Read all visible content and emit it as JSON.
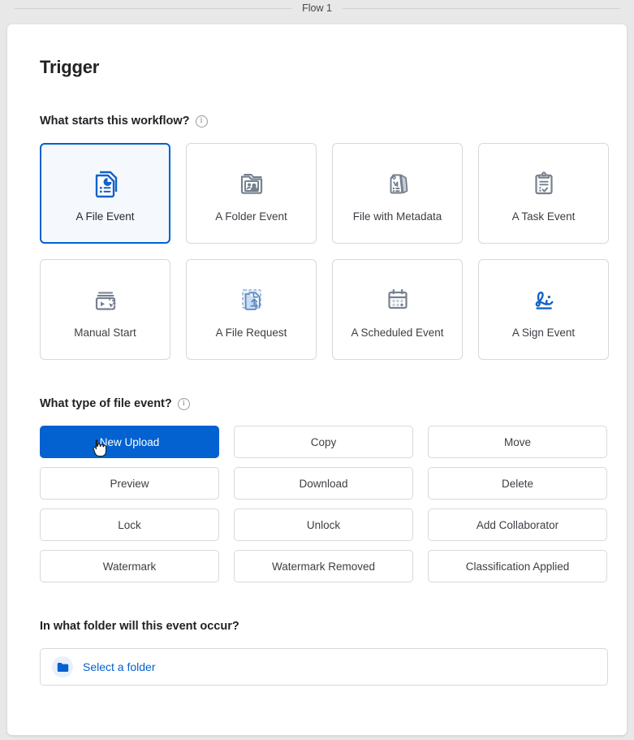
{
  "flow": {
    "title": "Flow 1"
  },
  "panel": {
    "title": "Trigger"
  },
  "questions": {
    "trigger": {
      "label": "What starts this workflow?",
      "info_icon": "info-icon",
      "info_glyph": "i"
    },
    "file_event": {
      "label": "What type of file event?",
      "info_icon": "info-icon",
      "info_glyph": "i"
    },
    "folder": {
      "label": "In what folder will this event occur?"
    }
  },
  "trigger_cards": [
    {
      "label": "A File Event",
      "icon": "file-document-chart-icon",
      "selected": true
    },
    {
      "label": "A Folder Event",
      "icon": "folder-people-icon",
      "selected": false
    },
    {
      "label": "File with Metadata",
      "icon": "metadata-tag-icon",
      "selected": false
    },
    {
      "label": "A Task Event",
      "icon": "clipboard-check-icon",
      "selected": false
    },
    {
      "label": "Manual Start",
      "icon": "manual-click-icon",
      "selected": false
    },
    {
      "label": "A File Request",
      "icon": "file-upload-request-icon",
      "selected": false
    },
    {
      "label": "A Scheduled Event",
      "icon": "calendar-icon",
      "selected": false
    },
    {
      "label": "A Sign Event",
      "icon": "signature-icon",
      "selected": false
    }
  ],
  "event_types": [
    {
      "label": "New Upload",
      "active": true
    },
    {
      "label": "Copy",
      "active": false
    },
    {
      "label": "Move",
      "active": false
    },
    {
      "label": "Preview",
      "active": false
    },
    {
      "label": "Download",
      "active": false
    },
    {
      "label": "Delete",
      "active": false
    },
    {
      "label": "Lock",
      "active": false
    },
    {
      "label": "Unlock",
      "active": false
    },
    {
      "label": "Add Collaborator",
      "active": false
    },
    {
      "label": "Watermark",
      "active": false
    },
    {
      "label": "Watermark Removed",
      "active": false
    },
    {
      "label": "Classification Applied",
      "active": false
    }
  ],
  "folder_select": {
    "placeholder_label": "Select a folder",
    "icon": "folder-icon"
  },
  "colors": {
    "accent_blue": "#0361d0",
    "selected_card_bg": "#f5f9fe",
    "border_gray": "#d6d9dd",
    "icon_gray": "#76818f",
    "page_bg": "#e8e8e8",
    "text_dark": "#222222"
  },
  "cursor": {
    "type": "pointer-hand"
  }
}
